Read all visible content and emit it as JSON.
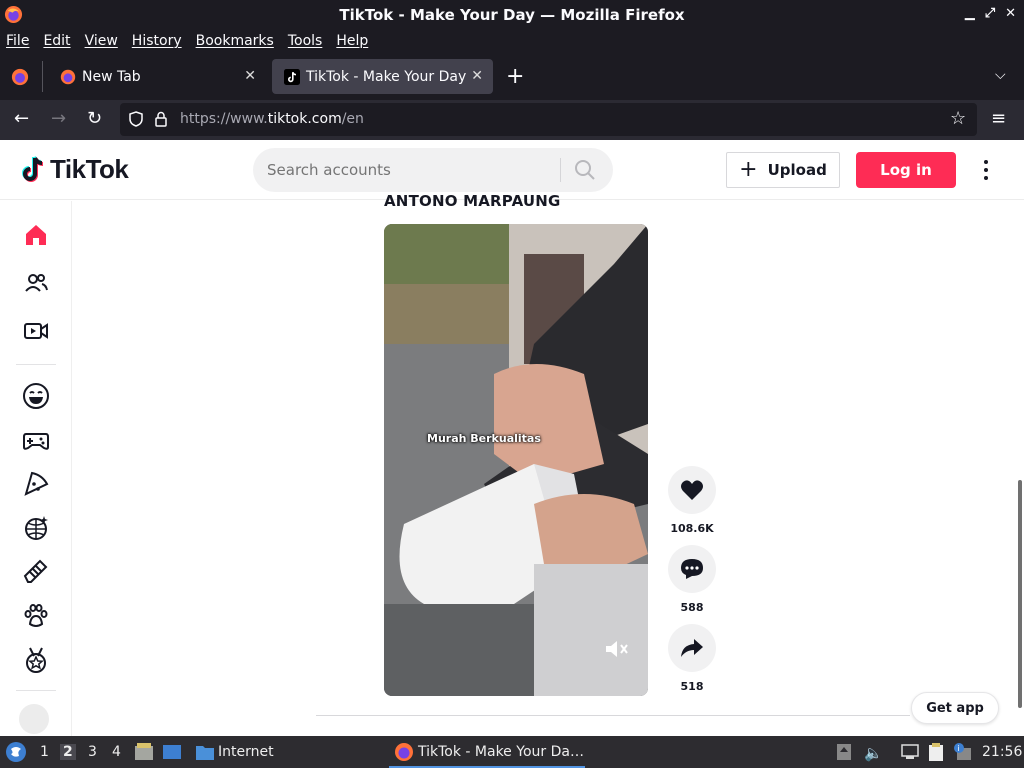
{
  "window": {
    "title": "TikTok - Make Your Day — Mozilla Firefox"
  },
  "menu": [
    "File",
    "Edit",
    "View",
    "History",
    "Bookmarks",
    "Tools",
    "Help"
  ],
  "tabs": [
    {
      "label": "New Tab"
    },
    {
      "label": "TikTok - Make Your Day"
    }
  ],
  "url": {
    "prefix": "https://www.",
    "domain": "tiktok.com",
    "path": "/en"
  },
  "site": {
    "logo_text": "TikTok",
    "search_placeholder": "Search accounts",
    "upload_label": "Upload",
    "login_label": "Log in",
    "get_app_label": "Get app"
  },
  "post": {
    "author": "ANTONO MARPAUNG",
    "caption": "Murah Berkualitas",
    "likes": "108.6K",
    "comments": "588",
    "shares": "518"
  },
  "taskbar": {
    "workspaces": [
      "1",
      "2",
      "3",
      "4"
    ],
    "app_label": "Internet",
    "task_label": "TikTok - Make Your Da…",
    "clock": "21:56"
  },
  "colors": {
    "accent": "#fe2c55",
    "chrome_dark": "#1c1b22",
    "taskbar": "#2d2c30"
  }
}
